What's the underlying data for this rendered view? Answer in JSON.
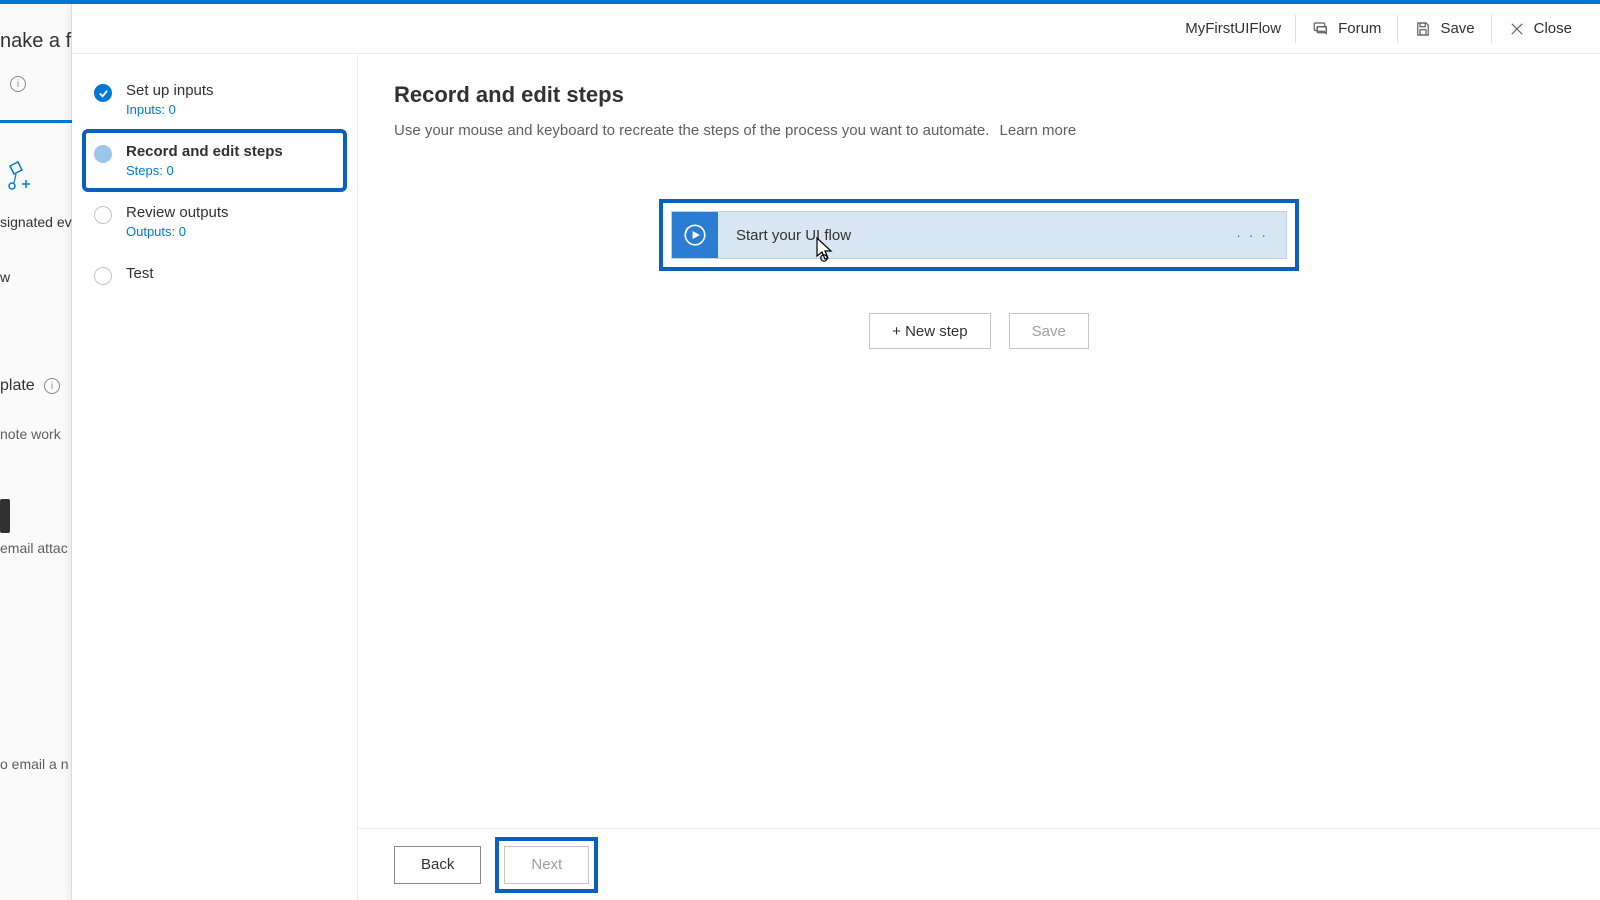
{
  "bg": {
    "heading_frag": "nake a fl",
    "signated": "signated even",
    "plate": "plate",
    "note": "note work",
    "email_attach": "email attac",
    "email_new": "o email a n"
  },
  "header": {
    "flow_name": "MyFirstUIFlow",
    "forum": "Forum",
    "save": "Save",
    "close": "Close"
  },
  "wizard": {
    "steps": [
      {
        "label": "Set up inputs",
        "sub": "Inputs: 0",
        "state": "done"
      },
      {
        "label": "Record and edit steps",
        "sub": "Steps: 0",
        "state": "active"
      },
      {
        "label": "Review outputs",
        "sub": "Outputs: 0",
        "state": "todo"
      },
      {
        "label": "Test",
        "sub": "",
        "state": "todo"
      }
    ]
  },
  "main": {
    "title": "Record and edit steps",
    "description": "Use your mouse and keyboard to recreate the steps of the process you want to automate.",
    "learn_more": "Learn more",
    "flow_card_title": "Start your UI flow",
    "new_step": "+ New step",
    "save": "Save"
  },
  "footer": {
    "back": "Back",
    "next": "Next"
  }
}
